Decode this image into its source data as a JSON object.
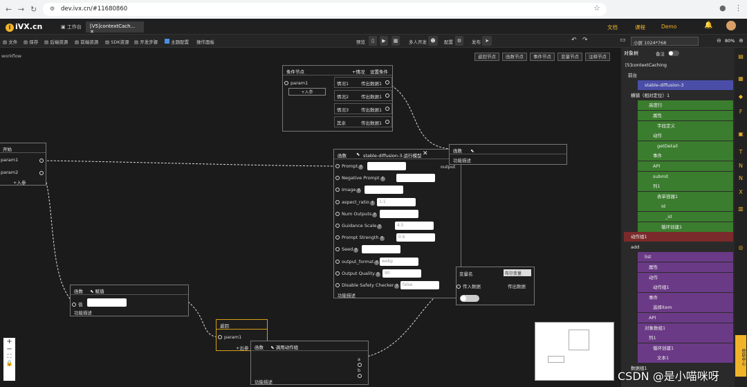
{
  "browser": {
    "url": "dev.ivx.cn/#11680860"
  },
  "app": {
    "logo": "iVX.cn",
    "tabs": [
      "工作台",
      "[V5]contextCach..."
    ],
    "header_links": [
      "文档",
      "课程",
      "Demo"
    ]
  },
  "toolbar": {
    "items": [
      "文件",
      "保存",
      "后端资源",
      "前端资源",
      "SDK资源",
      "开发步骤",
      "主题配置",
      "操作面板"
    ],
    "preview": "预览",
    "collab": "多人开发",
    "config": "配置",
    "publish": "发布",
    "screen": "小屏 1024*768",
    "zoom": "80%"
  },
  "canvas": {
    "breadcrumb": "workflow",
    "top_buttons": [
      "返回节点",
      "函数节点",
      "事件节点",
      "变量节点",
      "注释节点"
    ],
    "condition_node": {
      "title": "条件节点",
      "cases_label": "+情况",
      "settings": "设置条件",
      "param": "param1",
      "add_param": "+入参",
      "cases": [
        {
          "name": "情况1",
          "out": "传出数据1"
        },
        {
          "name": "情况2",
          "out": "传出数据1"
        },
        {
          "name": "情况3",
          "out": "传出数据1"
        },
        {
          "name": "其余",
          "out": "传出数据1"
        }
      ]
    },
    "start_node": {
      "title": "开始",
      "params": [
        "param1",
        "param2"
      ],
      "add": "+入参"
    },
    "func_node": {
      "title": "函数",
      "name": "stable-diffusion-3.运行模型",
      "output": "output",
      "desc": "功能描述",
      "fields": [
        {
          "label": "Prompt",
          "value": ""
        },
        {
          "label": "Negative Prompt",
          "value": ""
        },
        {
          "label": "Image",
          "value": ""
        },
        {
          "label": "aspect_ratio",
          "value": "1:1"
        },
        {
          "label": "Num Outputs",
          "value": ""
        },
        {
          "label": "Guidance Scale",
          "value": "4.5"
        },
        {
          "label": "Prompt Strength",
          "value": "0.6"
        },
        {
          "label": "Seed",
          "value": ""
        },
        {
          "label": "output_format",
          "value": "webp"
        },
        {
          "label": "Output Quality",
          "value": "90"
        },
        {
          "label": "Disable Safety Checker",
          "value": "false"
        }
      ]
    },
    "func_small": {
      "title": "函数",
      "desc": "功能描述"
    },
    "assign_node": {
      "title": "函数",
      "name": "赋值",
      "value_label": "值",
      "desc": "功能描述"
    },
    "var_node": {
      "title": "变量名",
      "select": "布尔变量",
      "in": "传入数据",
      "out": "传出数据"
    },
    "return_node": {
      "title": "返回",
      "param": "param1",
      "out": "+出参"
    },
    "call_node": {
      "title": "函数",
      "name": "调用动作组",
      "a": "a",
      "b": "b",
      "desc": "功能描述"
    }
  },
  "panel": {
    "title": "对象树",
    "remark": "备注",
    "tree": [
      "[5]contextCaching",
      "前台",
      "stable-diffusion-3",
      "横铺（相对定位）1",
      "高度行",
      "属性",
      "字段定义",
      "动作",
      "getDetail",
      "事件",
      "API",
      "submit",
      "列1",
      "表单容器1",
      "Id",
      "_id",
      "循环创建1",
      "动作组1",
      "add",
      "list",
      "属性",
      "动作",
      "动作组1",
      "事件",
      "选择item",
      "API",
      "对象数组1",
      "列1",
      "循环创建1",
      "文本1",
      "数据组1"
    ]
  },
  "help": "帮助中心",
  "watermark": "CSDN @是小喵咪呀"
}
